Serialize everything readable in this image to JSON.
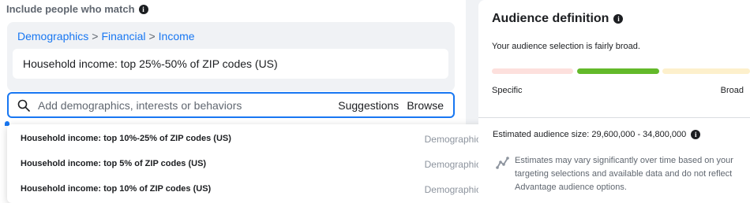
{
  "left": {
    "include_label": "Include people who match",
    "breadcrumb": [
      "Demographics",
      "Financial",
      "Income"
    ],
    "breadcrumb_separator": ">",
    "selected_item": "Household income: top 25%-50% of ZIP codes (US)",
    "search": {
      "placeholder": "Add demographics, interests or behaviors",
      "suggestions_label": "Suggestions",
      "browse_label": "Browse"
    },
    "dropdown": [
      {
        "label": "Household income: top 10%-25% of ZIP codes (US)",
        "category": "Demographics"
      },
      {
        "label": "Household income: top 5% of ZIP codes (US)",
        "category": "Demographics"
      },
      {
        "label": "Household income: top 10% of ZIP codes (US)",
        "category": "Demographics"
      }
    ]
  },
  "right": {
    "title": "Audience definition",
    "description": "Your audience selection is fairly broad.",
    "meter": {
      "left_label": "Specific",
      "right_label": "Broad",
      "active_segment": 2,
      "colors": [
        "#fde0dd",
        "#63b92a",
        "#fdf0cc"
      ]
    },
    "audience_size": "Estimated audience size: 29,600,000 - 34,800,000",
    "note": "Estimates may vary significantly over time based on your targeting selections and available data and do not reflect Advantage audience options."
  },
  "icons": {
    "info": "info-icon",
    "search": "search-icon",
    "trend": "trend-icon"
  },
  "colors": {
    "accent": "#1877f2",
    "text": "#1c1e21",
    "muted": "#606770"
  }
}
